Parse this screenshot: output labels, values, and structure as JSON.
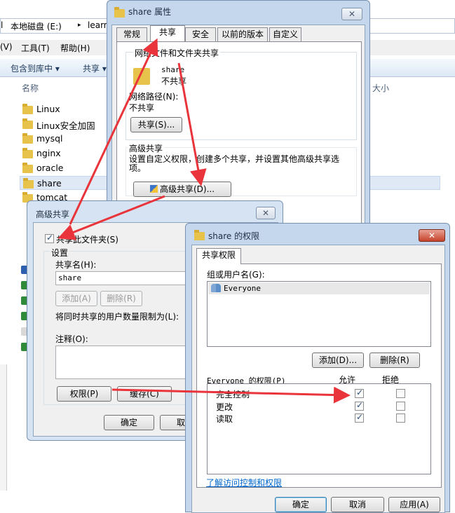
{
  "explorer": {
    "address": {
      "prefix": "l",
      "drive": "本地磁盘 (E:)",
      "sep": "▸",
      "folder": "learn"
    },
    "menu": {
      "view": "(V)",
      "tools": "工具(T)",
      "help": "帮助(H)"
    },
    "toolbar": {
      "include_library": "包含到库中 ▾",
      "share": "共享 ▾"
    },
    "columns": {
      "name": "名称",
      "size": "大小"
    },
    "files": [
      "Linux",
      "Linux安全加固",
      "mysql",
      "nginx",
      "oracle",
      "share",
      "tomcat"
    ]
  },
  "props_dialog": {
    "title": "share 属性",
    "tabs": [
      "常规",
      "共享",
      "安全",
      "以前的版本",
      "自定义"
    ],
    "net_group_label": "网络文件和文件夹共享",
    "folder_name": "share",
    "folder_status": "不共享",
    "net_path_label": "网络路径(N):",
    "net_path_value": "不共享",
    "share_button": "共享(S)...",
    "adv_group_label": "高级共享",
    "adv_desc": "设置自定义权限，创建多个共享，并设置其他高级共享选项。",
    "adv_button": "高级共享(D)..."
  },
  "adv_dialog": {
    "title": "高级共享",
    "share_checkbox": "共享此文件夹(S)",
    "settings_label": "设置",
    "share_name_label": "共享名(H):",
    "share_name_value": "share",
    "add_button": "添加(A)",
    "remove_button": "删除(R)",
    "limit_label": "将同时共享的用户数量限制为(L):",
    "comment_label": "注释(O):",
    "perm_button": "权限(P)",
    "cache_button": "缓存(C)",
    "ok_button": "确定",
    "cancel_button": "取消"
  },
  "perm_dialog": {
    "title": "share 的权限",
    "tab": "共享权限",
    "group_label": "组或用户名(G):",
    "users": [
      "Everyone"
    ],
    "add_button": "添加(D)...",
    "remove_button": "删除(R)",
    "perm_for_label": "Everyone 的权限(P)",
    "allow_header": "允许",
    "deny_header": "拒绝",
    "permissions": [
      {
        "name": "完全控制",
        "allow": true,
        "deny": false
      },
      {
        "name": "更改",
        "allow": true,
        "deny": false
      },
      {
        "name": "读取",
        "allow": true,
        "deny": false
      }
    ],
    "link": "了解访问控制和权限",
    "ok_button": "确定",
    "cancel_button": "取消",
    "apply_button": "应用(A)"
  },
  "colors": {
    "arrow": "#e8343a",
    "link": "#0066cc",
    "frame": "#c4d7ed"
  }
}
